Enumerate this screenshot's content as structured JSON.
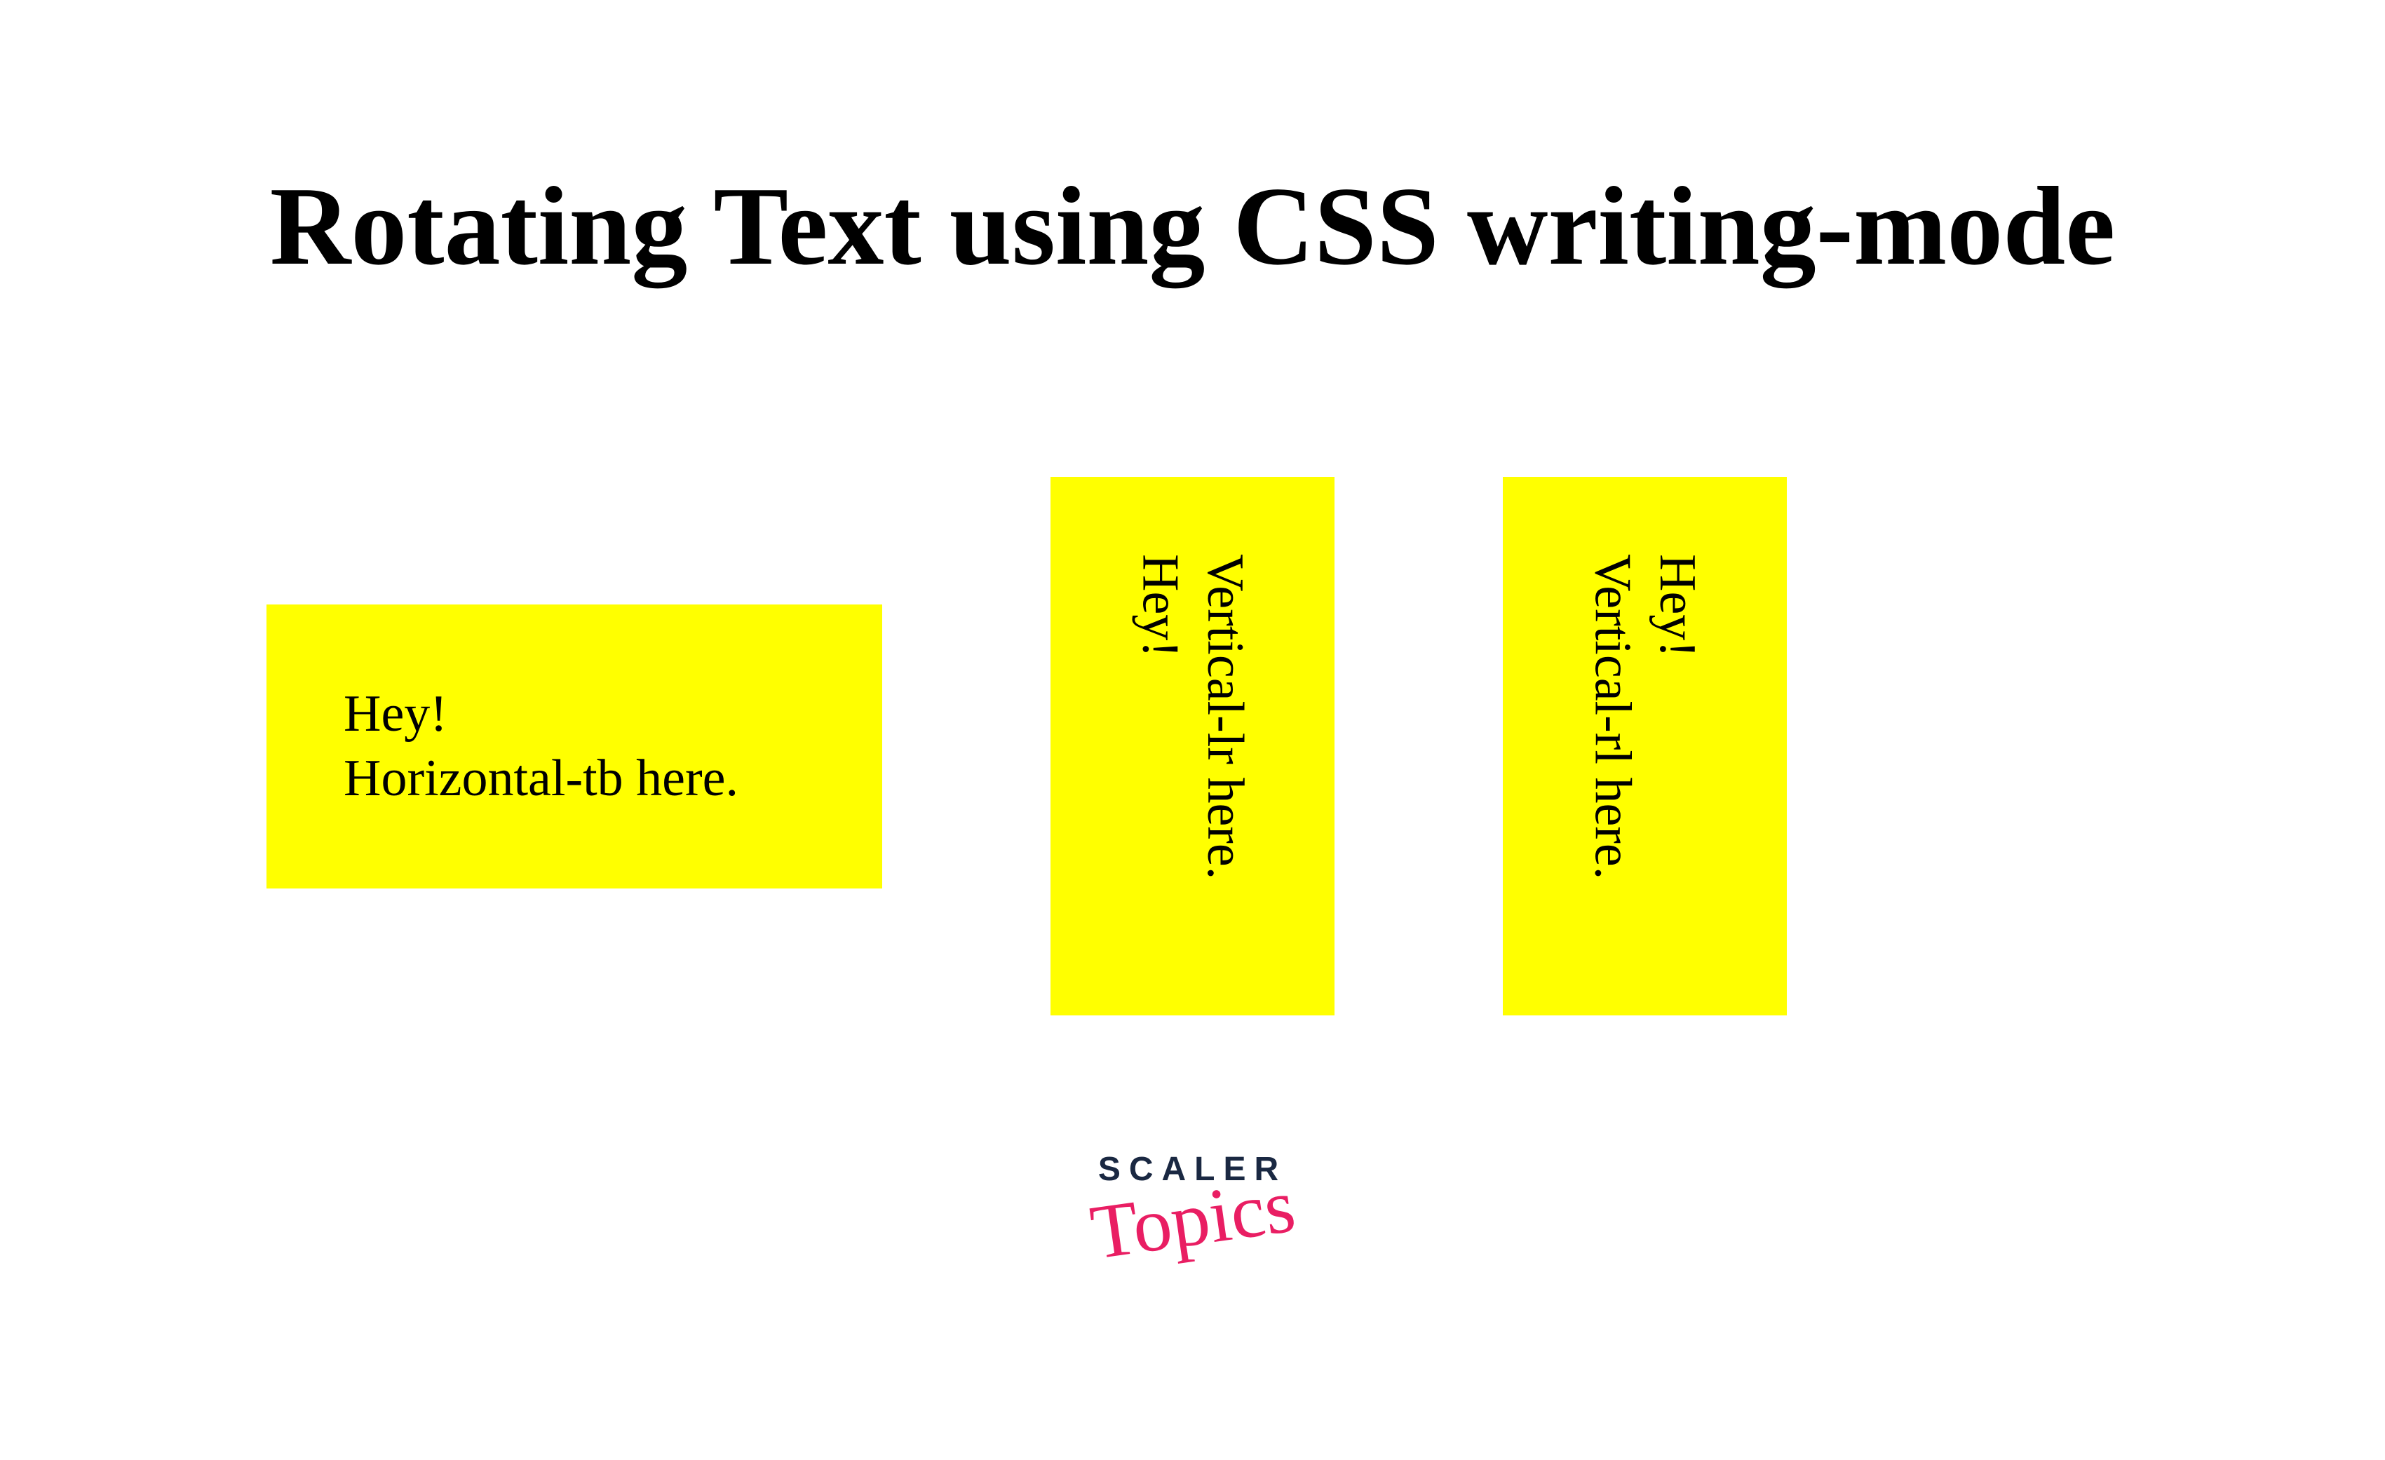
{
  "heading": "Rotating Text using CSS writing-mode",
  "boxes": {
    "horizontal": {
      "line1": "Hey!",
      "line2": "Horizontal-tb here."
    },
    "vertical_lr": {
      "line1": "Hey!",
      "line2": "Vertical-lr here."
    },
    "vertical_rl": {
      "line1": "Hey!",
      "line2": "Vertical-rl here."
    }
  },
  "logo": {
    "brand": "SCALER",
    "sub": "Topics"
  },
  "colors": {
    "box_bg": "#ffff00",
    "text": "#000000",
    "logo_brand": "#1a2842",
    "logo_sub": "#e91e63"
  }
}
